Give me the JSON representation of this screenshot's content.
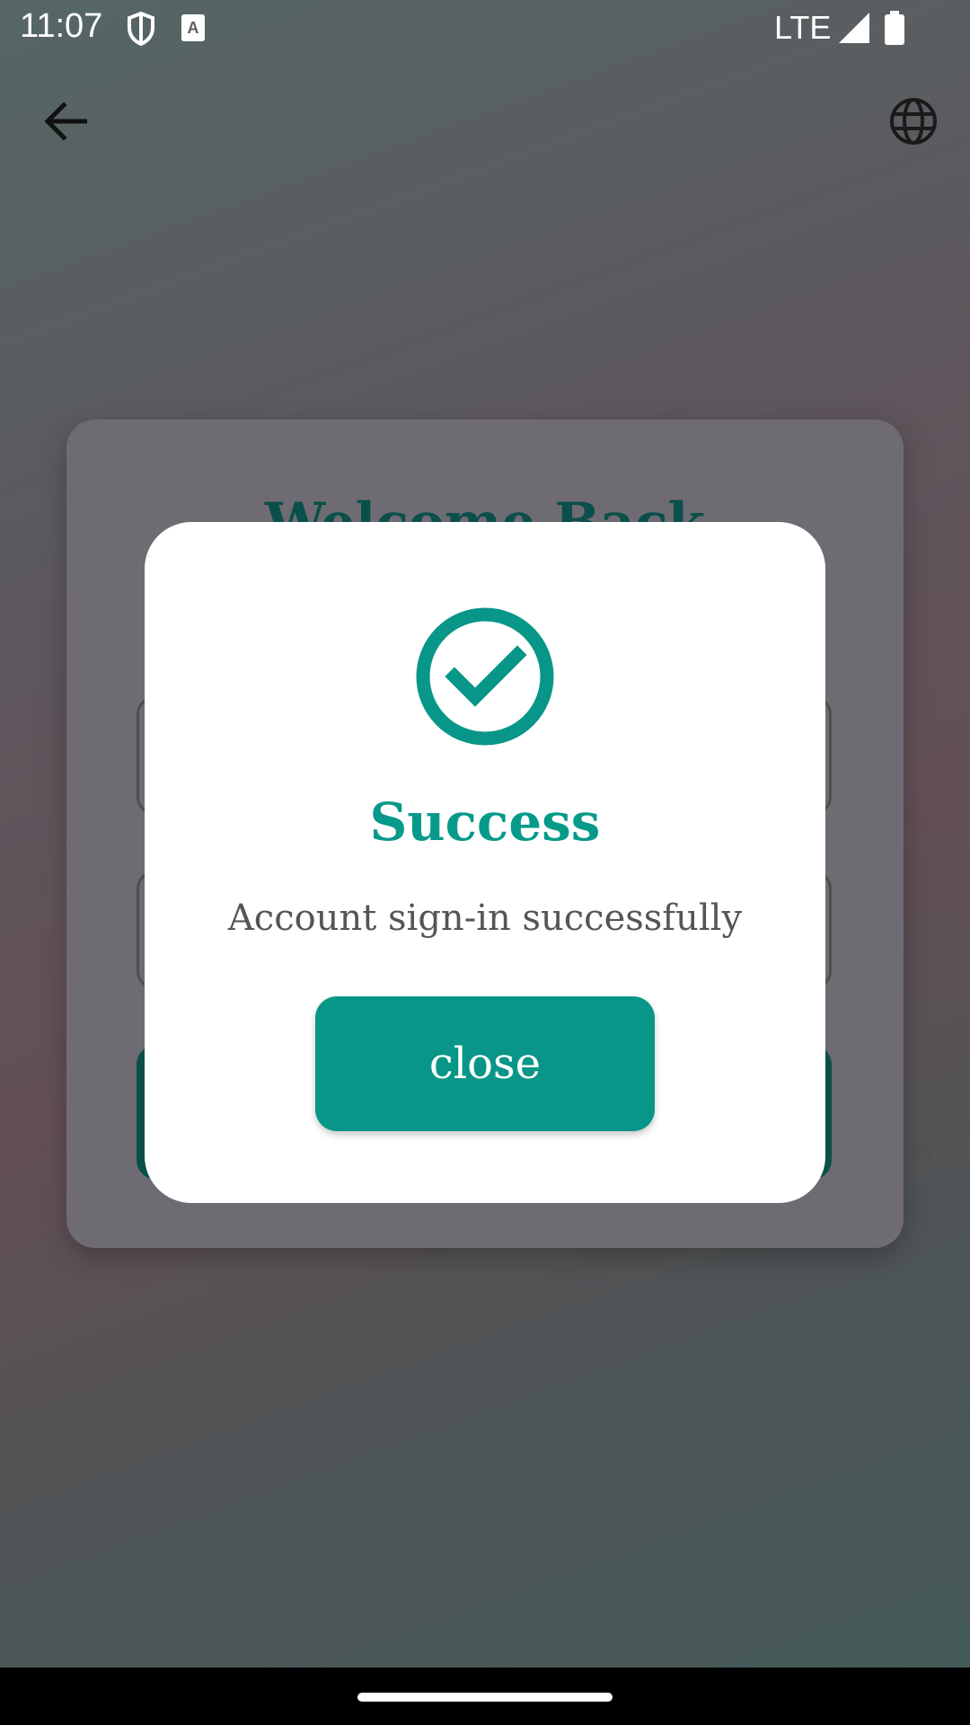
{
  "status_bar": {
    "time": "11:07",
    "network": "LTE",
    "icons": [
      "shield-icon",
      "text-recognition-icon",
      "signal-icon",
      "battery-icon"
    ]
  },
  "top_bar": {
    "back_icon": "arrow-back-icon",
    "language_icon": "globe-icon"
  },
  "login_card": {
    "title": "Welcome Back"
  },
  "dialog": {
    "icon": "check-circle-icon",
    "title": "Success",
    "message": "Account sign-in successfully",
    "close_label": "close"
  },
  "colors": {
    "accent": "#079687",
    "title": "#079a8a",
    "message": "#555555"
  }
}
